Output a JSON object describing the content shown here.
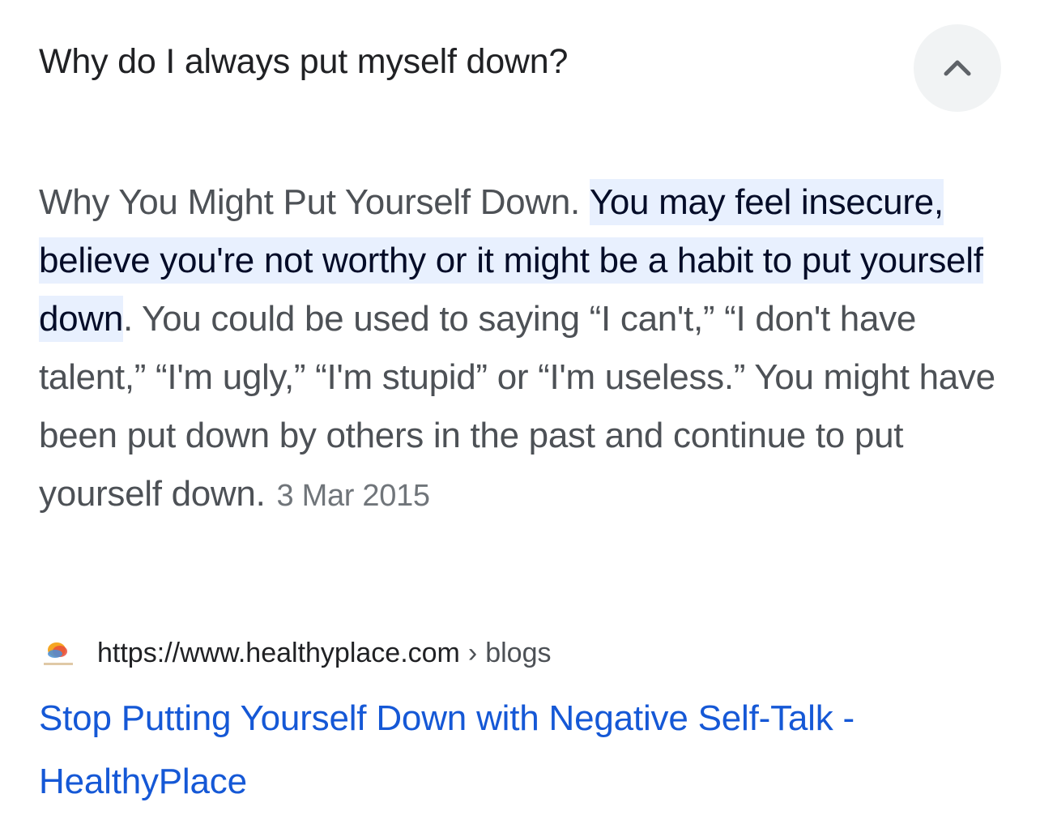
{
  "question": "Why do I always put myself down?",
  "collapse_icon": "chevron-up-icon",
  "answer": {
    "lead": "Why You Might Put Yourself Down. ",
    "highlight": "You may feel insecure, believe you're not worthy or it might be a habit to put yourself down",
    "rest": ". You could be used to saying “I can't,” “I don't have talent,” “I'm ugly,” “I'm stupid” or “I'm useless.” You might have been put down by others in the past and continue to put yourself down.",
    "date": "3 Mar 2015"
  },
  "source": {
    "favicon": "healthyplace-favicon",
    "url": "https://www.healthyplace.com",
    "separator": "›",
    "breadcrumb": "blogs"
  },
  "result": {
    "title": "Stop Putting Yourself Down with Negative Self-Talk - HealthyPlace"
  },
  "colors": {
    "highlight_bg": "#e8f0fe",
    "link": "#1558d6",
    "button_bg": "#f1f3f4"
  }
}
